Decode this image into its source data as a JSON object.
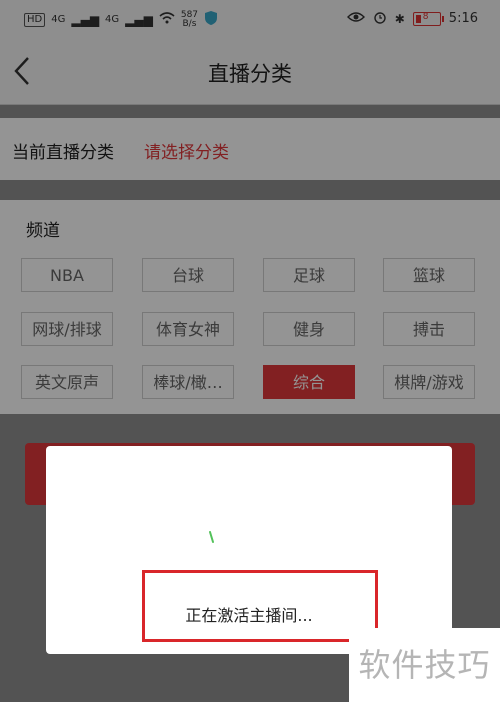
{
  "status_bar": {
    "left": {
      "hd": "HD",
      "net1": "4G",
      "net2": "4G",
      "speed": "587\nB/s"
    },
    "time": "5:16",
    "battery_level": "8"
  },
  "header": {
    "title": "直播分类"
  },
  "category": {
    "label": "当前直播分类",
    "value": "请选择分类"
  },
  "channels": {
    "heading": "频道",
    "items": [
      "NBA",
      "台球",
      "足球",
      "篮球",
      "网球/排球",
      "体育女神",
      "健身",
      "搏击",
      "英文原声",
      "棒球/橄…",
      "综合",
      "棋牌/游戏"
    ],
    "selected": "综合"
  },
  "dialog": {
    "loading_text": "正在激活主播间..."
  },
  "watermark": "软件技巧",
  "colors": {
    "accent": "#e0383b",
    "highlight": "#d9262a"
  }
}
